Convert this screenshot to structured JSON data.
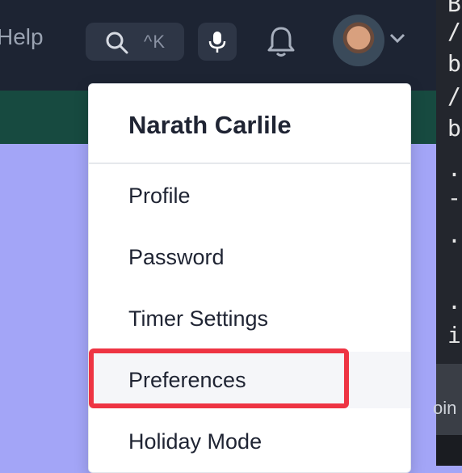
{
  "topbar": {
    "help_label": "Help",
    "search": {
      "shortcut": "^K",
      "icon": "search-icon"
    },
    "mic_icon": "microphone-icon",
    "bell_icon": "bell-icon",
    "avatar_icon": "user-avatar",
    "caret_icon": "chevron-down-icon"
  },
  "code_panel": {
    "lines": [
      "B",
      "/",
      "b",
      "/",
      "b",
      ".",
      "-",
      ".",
      ".",
      "i"
    ],
    "join_text": "oin"
  },
  "menu": {
    "user_name": "Narath Carlile",
    "items": [
      {
        "label": "Profile"
      },
      {
        "label": "Password"
      },
      {
        "label": "Timer Settings"
      },
      {
        "label": "Preferences"
      },
      {
        "label": "Holiday Mode"
      }
    ]
  },
  "colors": {
    "topbar_bg": "#1d2433",
    "green_bar": "#174a40",
    "content_bg": "#a3a5f7",
    "highlight": "#ee3443"
  }
}
